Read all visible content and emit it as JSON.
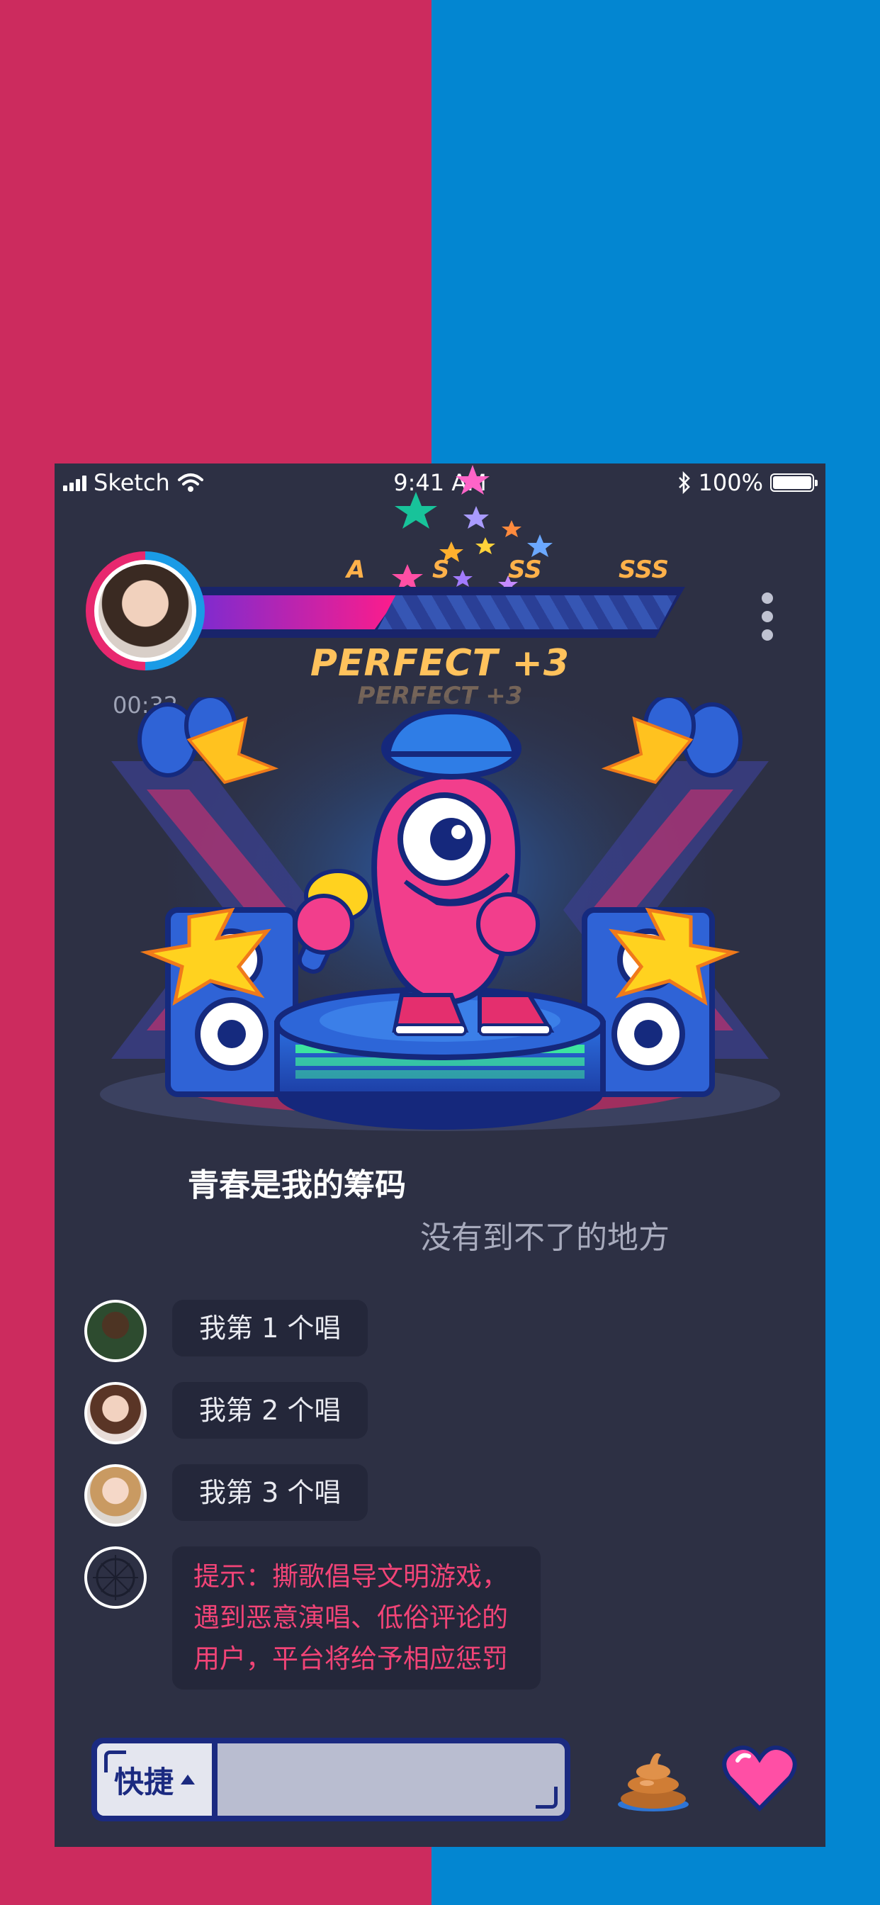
{
  "status_bar": {
    "carrier": "Sketch",
    "time": "9:41 AM",
    "battery": "100%",
    "battery_level": 1.0
  },
  "score": {
    "grades": [
      "A",
      "S",
      "SS",
      "SSS"
    ],
    "progress": 0.42,
    "timer": "00:32",
    "perfect_text": "PERFECT +3",
    "perfect_shadow_text": "PERFECT +3"
  },
  "lyrics": {
    "current": "青春是我的筹码",
    "next": "没有到不了的地方"
  },
  "chat": {
    "messages": [
      {
        "text": "我第 1 个唱"
      },
      {
        "text": "我第 2 个唱"
      },
      {
        "text": "我第 3 个唱"
      }
    ],
    "notice": [
      "提示：撕歌倡导文明游戏，",
      "遇到恶意演唱、低俗评论的",
      "用户，平台将给予相应惩罚"
    ]
  },
  "input": {
    "quick_label": "快捷",
    "placeholder": ""
  },
  "icons": {
    "poop": "poop-icon",
    "heart": "heart-icon"
  },
  "colors": {
    "left_bg": "#cc2b5e",
    "right_bg": "#0386d1",
    "phone_bg": "#2d3044",
    "accent_pink": "#f24477",
    "accent_navy": "#1b2a80"
  }
}
